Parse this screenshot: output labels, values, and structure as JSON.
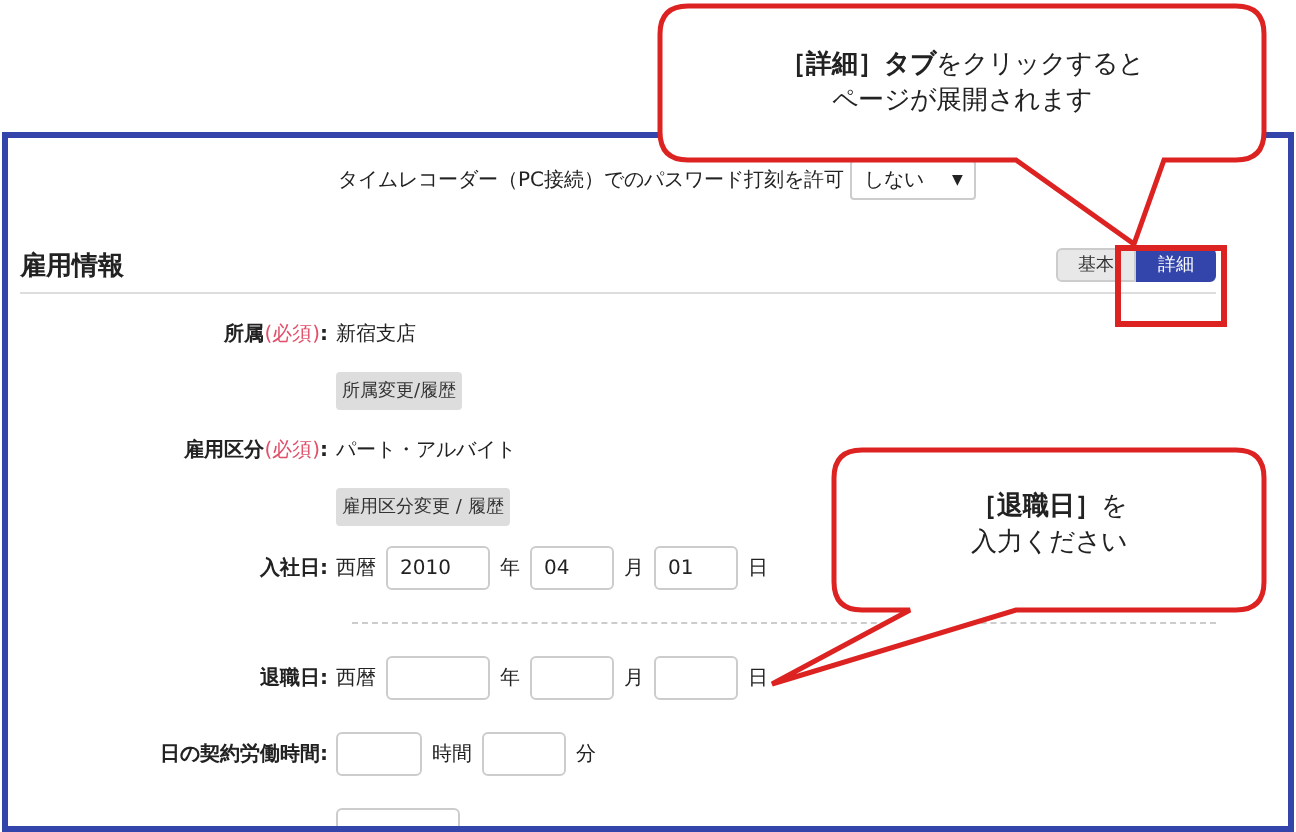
{
  "header": {
    "label": "タイムレコーダー（PC接続）でのパスワード打刻を許可",
    "select_value": "しない",
    "select_caret": "▼"
  },
  "section": {
    "title": "雇用情報",
    "tabs": [
      {
        "label": "基本",
        "selected": false
      },
      {
        "label": "詳細",
        "selected": true
      }
    ]
  },
  "fields": [
    {
      "kind": "text",
      "label": "所属",
      "required": "(必須)",
      "colon": ":",
      "value": "新宿支店",
      "button": "所属変更/履歴"
    },
    {
      "kind": "text",
      "label": "雇用区分",
      "required": "(必須)",
      "colon": ":",
      "value": "パート・アルバイト",
      "button": "雇用区分変更 / 履歴"
    },
    {
      "kind": "date",
      "label": "入社日:",
      "era": "西暦",
      "year": "2010",
      "year_unit": "年",
      "month": "04",
      "month_unit": "月",
      "day": "01",
      "day_unit": "日"
    },
    {
      "kind": "divider"
    },
    {
      "kind": "date",
      "label": "退職日:",
      "era": "西暦",
      "year_unit": "年",
      "month_unit": "月",
      "day_unit": "日"
    },
    {
      "kind": "duration",
      "label": "日の契約労働時間:",
      "hour_unit": "時間",
      "minute_unit": "分"
    },
    {
      "kind": "blank"
    }
  ],
  "callouts": [
    {
      "lines": [
        "**［詳細］タブ**をクリックすると",
        "ページが展開されます"
      ]
    },
    {
      "lines": [
        "**［退職日］**を",
        "入力ください"
      ]
    }
  ]
}
